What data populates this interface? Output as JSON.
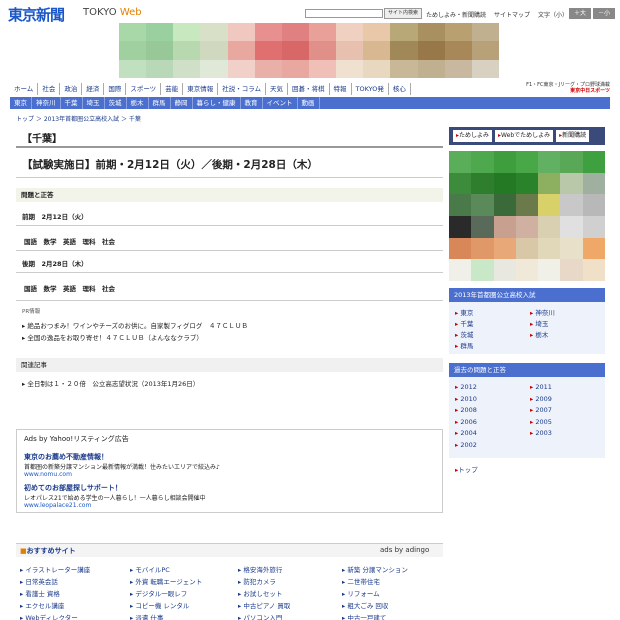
{
  "header": {
    "logo": "東京新聞",
    "logo_sub_a": "TOKYO",
    "logo_sub_b": "Web",
    "search_button": "サイト内検索",
    "links": [
      "ためしよみ・新聞購読",
      "サイトマップ"
    ],
    "fontsize_label": "文字（小）",
    "fontsize_plus": "＋大",
    "fontsize_minus": "－小"
  },
  "main_nav": [
    "ホーム",
    "社会",
    "政治",
    "経済",
    "国際",
    "スポーツ",
    "芸能",
    "東京情報",
    "社説・コラム",
    "天気",
    "囲碁・将棋",
    "特報",
    "TOKYO発",
    "核心"
  ],
  "right_logo": {
    "line1": "F1・FC東京・Jリーグ・プロ野球満載",
    "line2": "東京中日スポーツ"
  },
  "sub_nav": [
    "東京",
    "神奈川",
    "千葉",
    "埼玉",
    "茨城",
    "栃木",
    "群馬",
    "静岡",
    "暮らし・健康",
    "教育",
    "イベント",
    "動画"
  ],
  "breadcrumb": "トップ ＞ 2013年首都圏公立高校入試 ＞ 千葉",
  "main": {
    "pref_title": "【千葉】",
    "date_title": "【試験実施日】前期・2月12日（火）／後期・2月28日（木）",
    "section_problems": "問題と正答",
    "zenki_date": "前期　2月12日（火）",
    "zenki_subjects": "国語　数学　英語　理科　社会",
    "kouki_date": "後期　2月28日（木）",
    "kouki_subjects": "国語　数学　英語　理科　社会",
    "pr_label": "PR情報",
    "pr_links": [
      "絶品おつまみ！ワインやチーズのお供に。自家製フィグログ　４７ＣＬＵＢ",
      "全国の逸品をお取り寄せ！４７ＣＬＵＢ（よんななクラブ）"
    ],
    "section_related": "関連記事",
    "related_link": "全日制は１・２０倍　公立高志望状況（2013年1月26日）"
  },
  "ads": {
    "title": "Ads by Yahoo!リスティング広告",
    "items": [
      {
        "head": "東京のお薦め不動産情報！",
        "desc": "首都圏の新築分譲マンション最新情報が満載！住みたいエリアで絞込み♪",
        "url": "www.nomu.com"
      },
      {
        "head": "初めてのお部屋探しサポート！",
        "desc": "レオパレス21で始める学生の一人暮らし！一人暮らし相談会開催中",
        "url": "www.leopalace21.com"
      }
    ]
  },
  "osusume": {
    "title": "おすすめサイト",
    "adingo": "ads by adingo",
    "columns": [
      [
        "イラストレーター講座",
        "日常英会話",
        "看護士 資格",
        "エクセル講座",
        "Webディレクター"
      ],
      [
        "モバイルPC",
        "外資 転職エージェント",
        "デジタル一眼レフ",
        "コピー機 レンタル",
        "派遣 仕事"
      ],
      [
        "格安海外旅行",
        "防犯カメラ",
        "お試しセット",
        "中古ピアノ 買取",
        "パソコン入門"
      ],
      [
        "新築 分譲マンション",
        "二世帯住宅",
        "リフォーム",
        "粗大ごみ 回収",
        "中古一戸建て"
      ]
    ]
  },
  "sidebar": {
    "buttons": [
      "ためしよみ",
      "Webでためしよみ",
      "新聞購読"
    ],
    "exam_head": "2013年首都圏公立高校入試",
    "prefs_left": [
      "東京",
      "千葉",
      "茨城",
      "群馬"
    ],
    "prefs_right": [
      "神奈川",
      "埼玉",
      "栃木"
    ],
    "past_head": "過去の問題と正答",
    "years_left": [
      "2012",
      "2010",
      "2008",
      "2006",
      "2004",
      "2002"
    ],
    "years_right": [
      "2011",
      "2009",
      "2007",
      "2005",
      "2003"
    ],
    "top_link": "トップ"
  },
  "colors": {
    "accent_blue": "#4a6fcf",
    "nav_dark": "#3a4a7a",
    "logo_blue": "#1a57c8"
  }
}
